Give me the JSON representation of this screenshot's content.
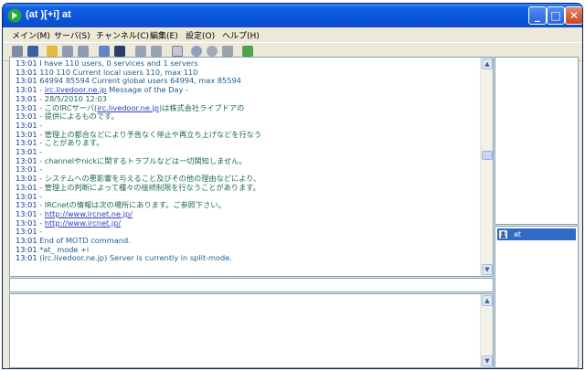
{
  "window": {
    "title": "(at )[+i] at"
  },
  "menu": [
    {
      "label": "メイン(M)"
    },
    {
      "label": "サーバ(S)"
    },
    {
      "label": "チャンネル(C)"
    },
    {
      "label": "編集(E)"
    },
    {
      "label": "設定(O)"
    },
    {
      "label": "ヘルプ(H)"
    }
  ],
  "titlebar_buttons": {
    "minimize": "_",
    "maximize": "□",
    "close": "✕"
  },
  "toolbar_icons": [
    "disconnect-icon",
    "server-list-icon",
    "folder-open-icon",
    "channel-join-icon",
    "channel-part-icon",
    "window-icon",
    "notify-icon",
    "lock-icon",
    "ignore-icon",
    "log-icon",
    "search-icon",
    "history-icon",
    "user-icon",
    "add-icon"
  ],
  "log": [
    {
      "ts": "13:01",
      "text": "I have 110 users, 0 services and 1 servers"
    },
    {
      "ts": "13:01",
      "text": "110 110 Current local users 110, max 110"
    },
    {
      "ts": "13:01",
      "text": "64994 85594 Current global users 64994, max 85594"
    },
    {
      "ts": "13:01",
      "pre": "- ",
      "link": "irc.livedoor.ne.jp",
      "post": " Message of the Day -"
    },
    {
      "ts": "13:01",
      "text": "- 28/5/2010 12:03",
      "green": true
    },
    {
      "ts": "13:01",
      "pre": "- このIRCサーバ(",
      "link": "irc.livedoor.ne.jp",
      "post": ")は株式会社ライブドアの",
      "green": true
    },
    {
      "ts": "13:01",
      "text": "- 提供によるものです。",
      "green": true
    },
    {
      "ts": "13:01",
      "text": "-",
      "green": true
    },
    {
      "ts": "13:01",
      "text": "- 管理上の都合などにより予告なく停止や再立ち上げなどを行なう",
      "green": true
    },
    {
      "ts": "13:01",
      "text": "- ことがあります。",
      "green": true
    },
    {
      "ts": "13:01",
      "text": "-",
      "green": true
    },
    {
      "ts": "13:01",
      "text": "- channelやnickに関するトラブルなどは一切関知しません。",
      "green": true
    },
    {
      "ts": "13:01",
      "text": "-",
      "green": true
    },
    {
      "ts": "13:01",
      "text": "- システムへの悪影響を与えること及びその他の理由などにより、",
      "green": true
    },
    {
      "ts": "13:01",
      "text": "- 管理上の判断によって種々の接続制限を行なうことがあります。",
      "green": true
    },
    {
      "ts": "13:01",
      "text": "-",
      "green": true
    },
    {
      "ts": "13:01",
      "text": "- IRCnetの情報は次の場所にあります。ご参照下さい。",
      "green": true
    },
    {
      "ts": "13:01",
      "pre": "-    ",
      "link": "http://www.ircnet.ne.jp/",
      "post": "",
      "green": true
    },
    {
      "ts": "13:01",
      "pre": "-    ",
      "link": "http://www.ircnet.jp/",
      "post": "",
      "green": true
    },
    {
      "ts": "13:01",
      "text": "-",
      "green": true
    },
    {
      "ts": "13:01",
      "text": "End of MOTD command."
    },
    {
      "ts": "13:01",
      "text": "*at_ mode +i"
    },
    {
      "ts": "13:01",
      "text": "(irc.livedoor.ne.jp) Server is currently in split-mode."
    }
  ],
  "nicklist": [
    {
      "nick": "at"
    }
  ],
  "input": {
    "value": ""
  },
  "colors": {
    "accent": "#316ac5",
    "title": "#0a55db",
    "timestamp": "#123d8f",
    "link": "#2a3fbf"
  }
}
